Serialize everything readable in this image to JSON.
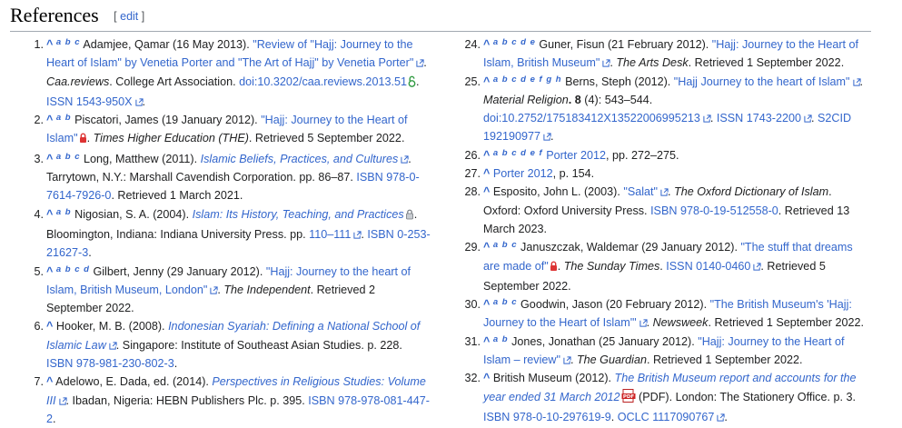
{
  "heading": {
    "title": "References",
    "edit_open": "[ ",
    "edit": "edit",
    "edit_close": " ]"
  },
  "refs": {
    "r1": {
      "num": "1.",
      "back": "^",
      "letters": "a b c",
      "author": "Adamjee, Qamar (16 May 2013). ",
      "title": "\"Review of \"Hajj: Journey to the Heart of Islam\" by Venetia Porter and \"The Art of Hajj\" by Venetia Porter\"",
      "sep": ". ",
      "journal": "Caa.reviews",
      "pub": ". College Art Association. ",
      "doi_label": "doi",
      "doi": ":10.3202/caa.reviews.2013.51",
      "issn_label": "ISSN",
      "issn": " 1543-950X",
      "end": "."
    },
    "r2": {
      "num": "2.",
      "back": "^",
      "letters": "a b",
      "author": "Piscatori, James (19 January 2012). ",
      "title": "\"Hajj: Journey to the Heart of Islam\"",
      "sep": ". ",
      "source": "Times Higher Education (THE)",
      "retrieved": ". Retrieved 5 September 2022."
    },
    "r3": {
      "num": "3.",
      "back": "^",
      "letters": "a b c",
      "author": "Long, Matthew (2011). ",
      "title": "Islamic Beliefs, Practices, and Cultures",
      "rest": ". Tarrytown, N.Y.: Marshall Cavendish Corporation. pp. 86–87. ",
      "isbn_label": "ISBN",
      "isbn": " 978-0-7614-7926-0",
      "retrieved": ". Retrieved 1 March 2021."
    },
    "r4": {
      "num": "4.",
      "back": "^",
      "letters": "a b",
      "author": "Nigosian, S. A. (2004). ",
      "title": "Islam: Its History, Teaching, and Practices",
      "rest": ". Bloomington, Indiana: Indiana University Press. pp. ",
      "pages": "110–111",
      "sep": ". ",
      "isbn_label": "ISBN",
      "isbn": " 0-253-21627-3",
      "end": "."
    },
    "r5": {
      "num": "5.",
      "back": "^",
      "letters": "a b c d",
      "author": "Gilbert, Jenny (29 January 2012). ",
      "title": "\"Hajj: Journey to the heart of Islam, British Museum, London\"",
      "sep": ". ",
      "source": "The Independent",
      "retrieved": ". Retrieved 2 September 2022."
    },
    "r6": {
      "num": "6.",
      "back": "^",
      "author": "Hooker, M. B. (2008). ",
      "title": "Indonesian Syariah: Defining a National School of Islamic Law",
      "rest": ". Singapore: Institute of Southeast Asian Studies. p. 228. ",
      "isbn_label": "ISBN",
      "isbn": " 978-981-230-802-3",
      "end": "."
    },
    "r7": {
      "num": "7.",
      "back": "^",
      "author": "Adelowo, E. Dada, ed. (2014). ",
      "title": "Perspectives in Religious Studies: Volume III",
      "rest": ". Ibadan, Nigeria: HEBN Publishers Plc. p. 395. ",
      "isbn_label": "ISBN",
      "isbn": " 978-978-081-447-2",
      "end": "."
    },
    "r24": {
      "num": "24.",
      "back": "^",
      "letters": "a b c d e",
      "author": "Guner, Fisun (21 February 2012). ",
      "title": "\"Hajj: Journey to the Heart of Islam, British Museum\"",
      "sep": ". ",
      "source": "The Arts Desk",
      "retrieved": ". Retrieved 1 September 2022."
    },
    "r25": {
      "num": "25.",
      "back": "^",
      "letters": "a b c d e f g h",
      "author": "Berns, Steph (2012). ",
      "title": "\"Hajj Journey to the heart of Islam\"",
      "sep": ". ",
      "journal": "Material Religion",
      "volume": ". 8",
      "issue": " (4): 543–544. ",
      "doi_label": "doi",
      "doi": ":10.2752/175183412X13522006995213",
      "sep2": ". ",
      "issn_label": "ISSN",
      "issn": " 1743-2200",
      "sep3": ". ",
      "s2cid_label": "S2CID",
      "s2cid": " 192190977",
      "end": "."
    },
    "r26": {
      "num": "26.",
      "back": "^",
      "letters": "a b c d e f",
      "cite": "Porter 2012",
      "rest": ", pp. 272–275."
    },
    "r27": {
      "num": "27.",
      "back": "^",
      "cite": "Porter 2012",
      "rest": ", p. 154."
    },
    "r28": {
      "num": "28.",
      "back": "^",
      "author": "Esposito, John L. (2003). ",
      "title": "\"Salat\"",
      "sep": ". ",
      "source": "The Oxford Dictionary of Islam",
      "rest": ". Oxford: Oxford University Press. ",
      "isbn_label": "ISBN",
      "isbn": " 978-0-19-512558-0",
      "retrieved": ". Retrieved 13 March 2023."
    },
    "r29": {
      "num": "29.",
      "back": "^",
      "letters": "a b c",
      "author": "Januszczak, Waldemar (29 January 2012). ",
      "title": "\"The stuff that dreams are made of\"",
      "sep": ". ",
      "source": "The Sunday Times",
      "sep2": ". ",
      "issn_label": "ISSN",
      "issn": " 0140-0460",
      "retrieved": ". Retrieved 5 September 2022."
    },
    "r30": {
      "num": "30.",
      "back": "^",
      "letters": "a b c",
      "author": "Goodwin, Jason (20 February 2012). ",
      "title": "\"The British Museum's 'Hajj: Journey to the Heart of Islam'\"",
      "sep": ". ",
      "source": "Newsweek",
      "retrieved": ". Retrieved 1 September 2022."
    },
    "r31": {
      "num": "31.",
      "back": "^",
      "letters": "a b",
      "author": "Jones, Jonathan (25 January 2012). ",
      "title": "\"Hajj: Journey to the Heart of Islam – review\"",
      "sep": ". ",
      "source": "The Guardian",
      "retrieved": ". Retrieved 1 September 2022."
    },
    "r32": {
      "num": "32.",
      "back": "^",
      "author": "British Museum (2012). ",
      "title": "The British Museum report and accounts for the year ended 31 March 2012",
      "pdf_icon_text": "PDF",
      "format": " (PDF)",
      "rest": ". London: The Stationery Office. p. 3. ",
      "isbn_label": "ISBN",
      "isbn": " 978-0-10-297619-9",
      "sep2": ". ",
      "oclc_label": "OCLC",
      "oclc": " 1117090767",
      "end": "."
    }
  }
}
